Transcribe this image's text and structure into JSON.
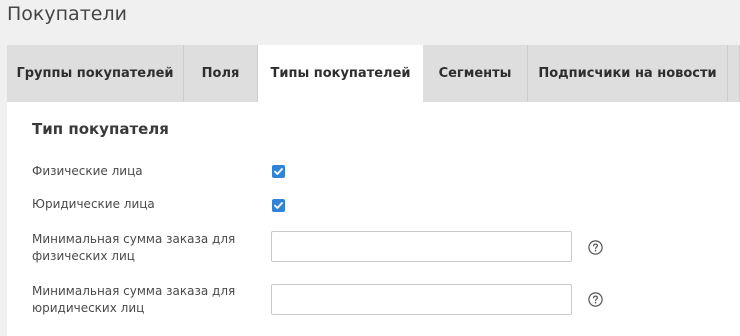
{
  "page": {
    "title": "Покупатели"
  },
  "tabs": [
    {
      "label": "Группы покупателей",
      "active": false
    },
    {
      "label": "Поля",
      "active": false
    },
    {
      "label": "Типы покупателей",
      "active": true
    },
    {
      "label": "Сегменты",
      "active": false
    },
    {
      "label": "Подписчики на новости",
      "active": false
    }
  ],
  "section": {
    "title": "Тип покупателя"
  },
  "form": {
    "individuals": {
      "label": "Физические лица",
      "checked": true
    },
    "legal_entities": {
      "label": "Юридические лица",
      "checked": true
    },
    "min_order_individuals": {
      "label": "Минимальная сумма заказа для физических лиц",
      "value": "",
      "placeholder": ""
    },
    "min_order_legal": {
      "label": "Минимальная сумма заказа для юридических лиц",
      "value": "",
      "placeholder": ""
    }
  },
  "colors": {
    "accent": "#2f84d8",
    "tab_background": "#dedede",
    "page_background": "#f0f0f0"
  },
  "icons": {
    "checkbox": "check-icon",
    "help": "question-circle-icon"
  }
}
